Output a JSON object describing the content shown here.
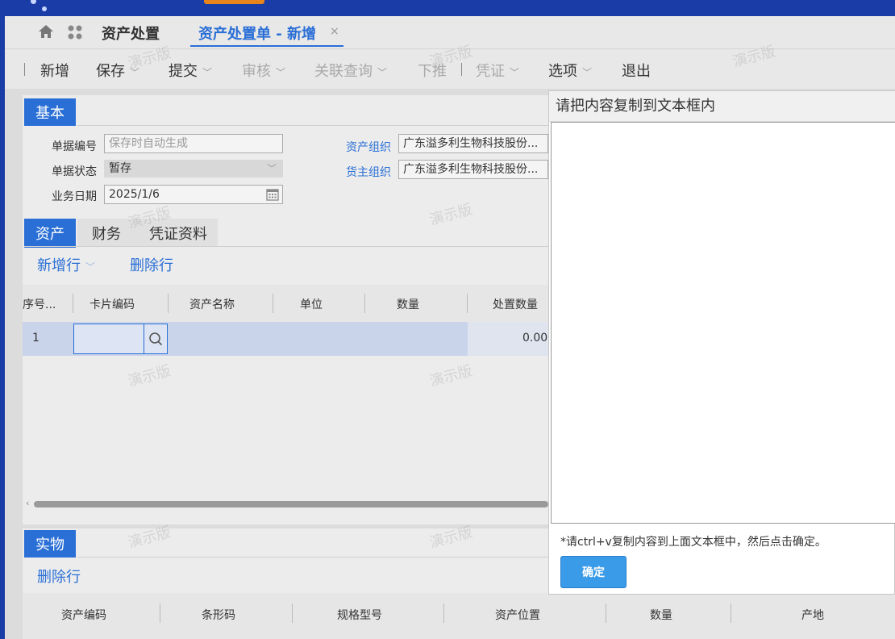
{
  "colors": {
    "brand": "#1a3ca6",
    "accent": "#2a6fd6",
    "ok_button": "#3a9be8",
    "selected_row": "#c9d3ea"
  },
  "tabbar": {
    "home_icon": "home-icon",
    "apps_icon": "apps-icon",
    "module_title": "资产处置",
    "active_tab": "资产处置单 - 新增",
    "close": "×"
  },
  "toolbar": {
    "add": "新增",
    "save": "保存",
    "submit": "提交",
    "audit": "审核",
    "related_query": "关联查询",
    "push_down": "下推",
    "voucher": "凭证",
    "options": "选项",
    "exit": "退出",
    "chevron": "﹀"
  },
  "basic": {
    "section_label": "基本",
    "bill_no_label": "单据编号",
    "bill_no_placeholder": "保存时自动生成",
    "bill_status_label": "单据状态",
    "bill_status_value": "暂存",
    "biz_date_label": "业务日期",
    "biz_date_value": "2025/1/6",
    "asset_org_label": "资产组织",
    "asset_org_value": "广东溢多利生物科技股份...",
    "owner_org_label": "货主组织",
    "owner_org_value": "广东溢多利生物科技股份..."
  },
  "subtabs": [
    "资产",
    "财务",
    "凭证资料"
  ],
  "entry_actions": {
    "add_row": "新增行",
    "delete_row": "删除行"
  },
  "grid": {
    "columns": [
      "序号...",
      "卡片编码",
      "资产名称",
      "单位",
      "数量",
      "处置数量"
    ],
    "rows": [
      {
        "seq": "1",
        "disposal_qty": "0.00"
      }
    ]
  },
  "physical": {
    "section_label": "实物",
    "delete_row": "删除行",
    "columns": [
      "资产编码",
      "条形码",
      "规格型号",
      "资产位置",
      "数量",
      "产地"
    ]
  },
  "watermark": "演示版",
  "dialog": {
    "title": "请把内容复制到文本框内",
    "hint": "*请ctrl+v复制内容到上面文本框中，然后点击确定。",
    "ok": "确定"
  }
}
